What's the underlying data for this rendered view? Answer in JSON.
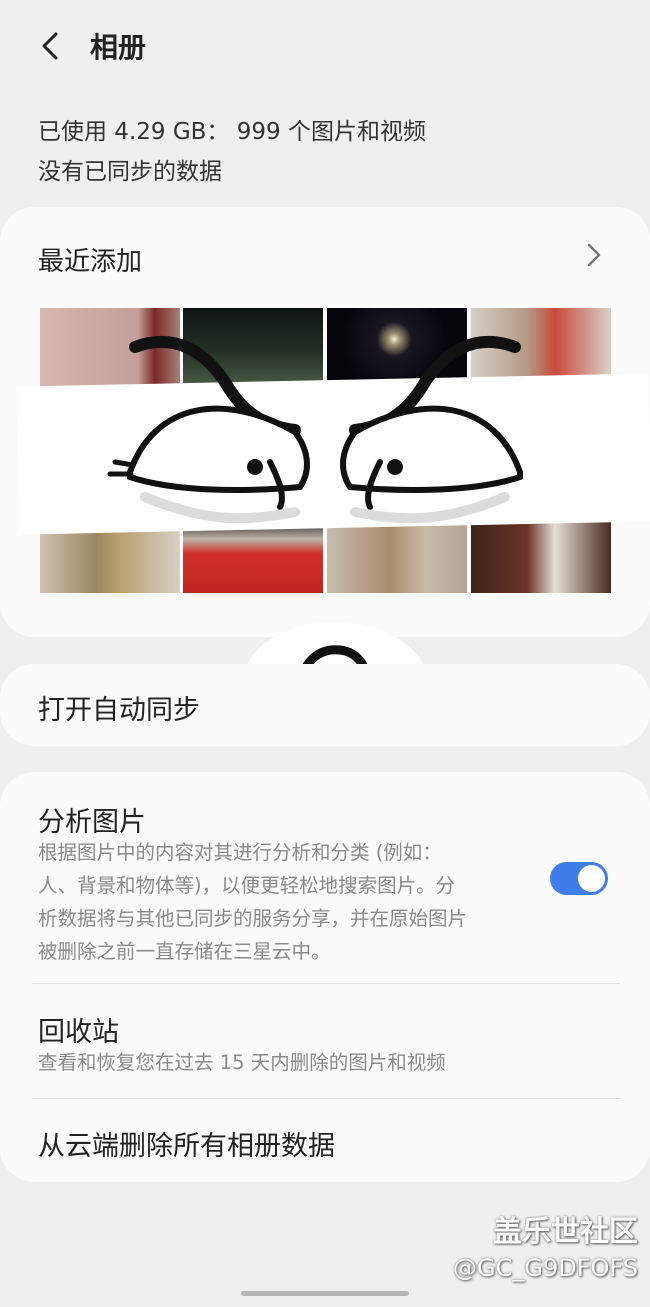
{
  "header": {
    "title": "相册",
    "back_icon": "chevron-left-icon"
  },
  "usage": {
    "line1": "已使用 4.29 GB： 999 个图片和视频",
    "line2": "没有已同步的数据"
  },
  "recent": {
    "label": "最近添加",
    "chevron_icon": "chevron-right-icon",
    "thumbnails": [
      {
        "desc": "pink wall photo",
        "color": "#c9a9a2"
      },
      {
        "desc": "night square photo",
        "color": "#1f2622"
      },
      {
        "desc": "night fireworks photo",
        "color": "#0d0c14"
      },
      {
        "desc": "child with backpack photo",
        "color": "#a8968a"
      },
      {
        "desc": "child standing photo",
        "color": "#b8a288"
      },
      {
        "desc": "child on red podium photo",
        "color": "#c92b25"
      },
      {
        "desc": "child on pavement photo",
        "color": "#b5a497"
      },
      {
        "desc": "dark sign photo",
        "color": "#4b2a20"
      }
    ]
  },
  "sync": {
    "label": "打开自动同步"
  },
  "analyze": {
    "title": "分析图片",
    "desc_lines": [
      "根据图片中的内容对其进行分析和分类 (例如：",
      "人、背景和物体等)，以便更轻松地搜索图片。分",
      "析数据将与其他已同步的服务分享，并在原始图片",
      "被删除之前一直存储在三星云中。"
    ],
    "toggle_on": true,
    "accent": "#3f7ded"
  },
  "trash": {
    "title": "回收站",
    "desc": "查看和恢复您在过去 15 天内删除的图片和视频"
  },
  "delete_all": {
    "label": "从云端删除所有相册数据"
  },
  "watermark": {
    "line1": "盖乐世社区",
    "line2": "@GC_G9DFOFS"
  }
}
